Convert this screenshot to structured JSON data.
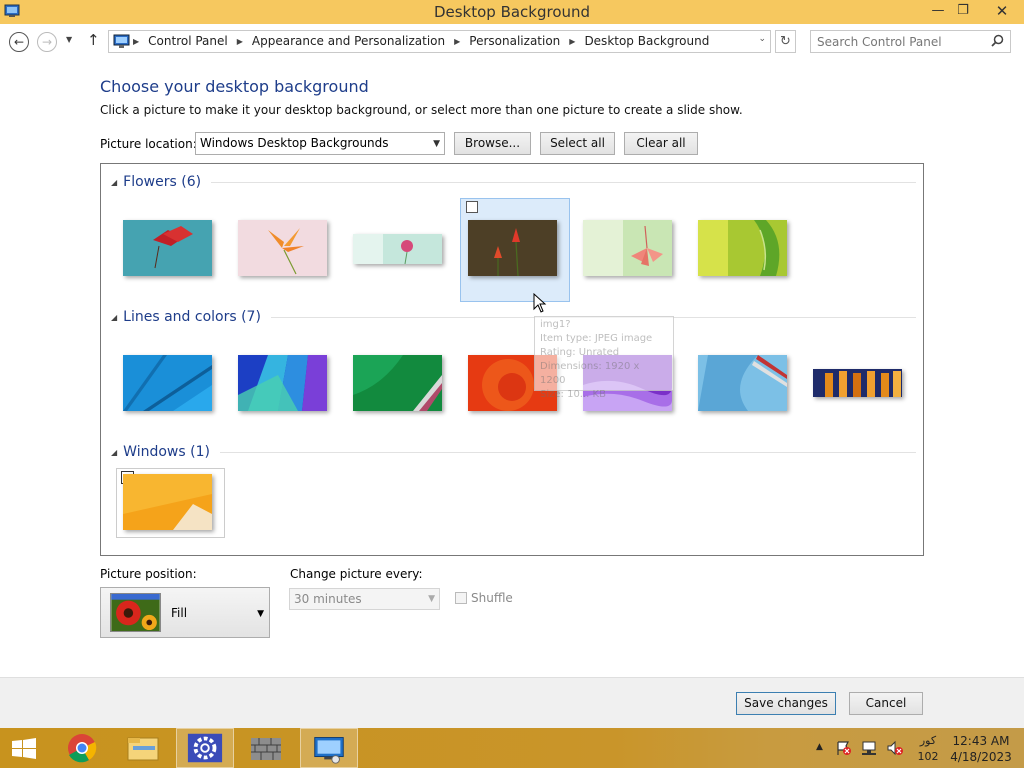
{
  "window": {
    "title": "Desktop Background",
    "min_glyph": "—",
    "max_glyph": "❐",
    "close_glyph": "✕"
  },
  "address_bar": {
    "breadcrumbs": [
      "Control Panel",
      "Appearance and Personalization",
      "Personalization",
      "Desktop Background"
    ],
    "search_placeholder": "Search Control Panel"
  },
  "main": {
    "heading": "Choose your desktop background",
    "instructions": "Click a picture to make it your desktop background, or select more than one picture to create a slide show.",
    "picture_location_label": "Picture location:",
    "picture_location_value": "Windows Desktop Backgrounds",
    "browse_label": "Browse...",
    "select_all_label": "Select all",
    "clear_all_label": "Clear all"
  },
  "groups": [
    {
      "name": "Flowers (6)",
      "count": 6
    },
    {
      "name": "Lines and colors (7)",
      "count": 7
    },
    {
      "name": "Windows (1)",
      "count": 1
    }
  ],
  "tooltip": {
    "lines": [
      "img1?",
      "Item type: JPEG image",
      "Rating: Unrated",
      "Dimensions: 1920 x 1200",
      "Size: 10... KB"
    ]
  },
  "bottom": {
    "picture_position_label": "Picture position:",
    "picture_position_value": "Fill",
    "change_picture_label": "Change picture every:",
    "change_picture_value": "30 minutes",
    "shuffle_label": "Shuffle"
  },
  "footer": {
    "save_label": "Save changes",
    "cancel_label": "Cancel"
  },
  "taskbar": {
    "lang_line1": "کور",
    "lang_line2": "102",
    "time": "12:43 AM",
    "date": "4/18/2023"
  }
}
